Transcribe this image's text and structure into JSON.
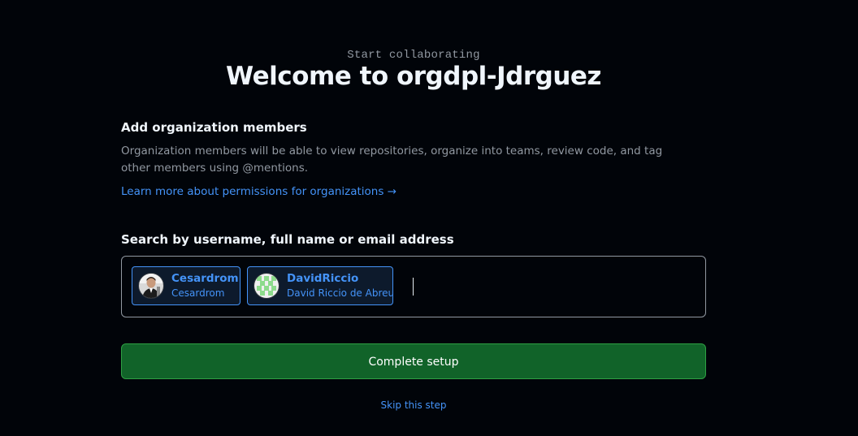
{
  "header": {
    "kicker": "Start collaborating",
    "title": "Welcome to orgdpl-Jdrguez"
  },
  "members_section": {
    "heading": "Add organization members",
    "description": "Organization members will be able to view repositories, organize into teams, review code, and tag other members using @mentions.",
    "learn_more_link": "Learn more about permissions for organizations →"
  },
  "search": {
    "label": "Search by username, full name or email address",
    "selected_users": [
      {
        "login": "Cesardrom",
        "name": "Cesardrom",
        "avatar": "photo-avatar"
      },
      {
        "login": "DavidRiccio",
        "name": "David Riccio de Abreu",
        "avatar": "identicon-avatar"
      }
    ],
    "value": ""
  },
  "actions": {
    "complete_label": "Complete setup",
    "skip_label": "Skip this step"
  },
  "colors": {
    "background": "#010409",
    "accent_link": "#4493f8",
    "button_green": "#116329",
    "button_border": "#2ea043",
    "identicon_green": "#8ddb8c"
  }
}
